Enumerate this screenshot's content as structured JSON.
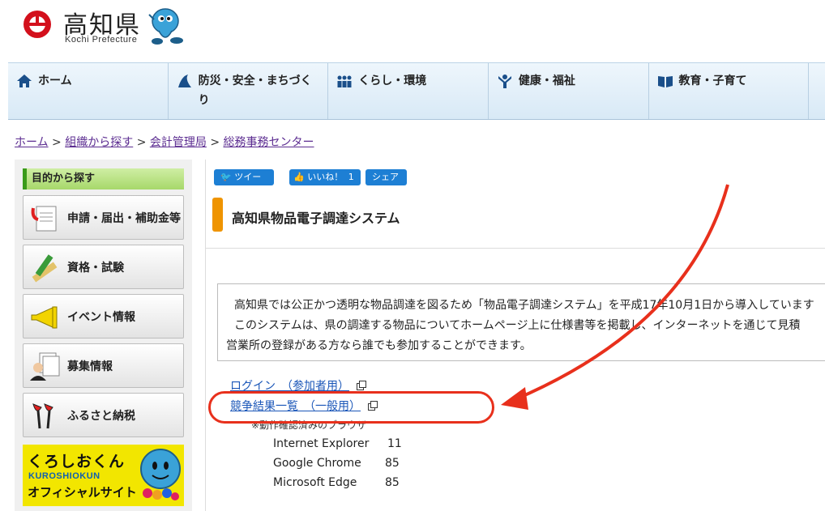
{
  "header": {
    "title": "高知県",
    "subtitle": "Kochi Prefecture"
  },
  "nav": [
    {
      "label": "ホーム",
      "icon": "home-icon"
    },
    {
      "label": "防災・安全・まちづくり",
      "icon": "tsunami-icon"
    },
    {
      "label": "くらし・環境",
      "icon": "people-icon"
    },
    {
      "label": "健康・福祉",
      "icon": "person-arms-icon"
    },
    {
      "label": "教育・子育て",
      "icon": "book-icon"
    }
  ],
  "breadcrumb": {
    "items": [
      "ホーム",
      "組織から探す",
      "会計管理局",
      "総務事務センター"
    ],
    "separator": ">"
  },
  "sidebar": {
    "heading": "目的から探す",
    "items": [
      {
        "label": "申請・届出・補助金等",
        "icon": "form-icon"
      },
      {
        "label": "資格・試験",
        "icon": "pencil-ruler-icon"
      },
      {
        "label": "イベント情報",
        "icon": "megaphone-icon"
      },
      {
        "label": "募集情報",
        "icon": "recruit-icon"
      },
      {
        "label": "ふるさと納税",
        "icon": "naruko-icon"
      }
    ],
    "banner": {
      "jp": "くろしおくん",
      "en": "KUROSHIOKUN",
      "site": "オフィシャルサイト"
    }
  },
  "social": {
    "tweet": "ツイート",
    "like": "いいね！",
    "like_count": "1",
    "share": "シェア"
  },
  "page": {
    "title": "高知県物品電子調達システム",
    "intro_lines": [
      "高知県では公正かつ透明な物品調達を図るため「物品電子調達システム」を平成17年10月1日から導入しています",
      "このシステムは、県の調達する物品についてホームページ上に仕様書等を掲載し、インターネットを通じて見積",
      "営業所の登録がある方なら誰でも参加することができます。"
    ],
    "links": [
      {
        "label": "ログイン　（参加者用）"
      },
      {
        "label": "競争結果一覧　（一般用）"
      }
    ],
    "browser_note": "※動作確認済みのブラウザ",
    "browsers": [
      {
        "name": "Internet Explorer",
        "version": "11"
      },
      {
        "name": "Google Chrome",
        "version": "85"
      },
      {
        "name": "Microsoft Edge",
        "version": "85"
      }
    ]
  },
  "colors": {
    "annotation": "#e8301c",
    "link": "#1a56b8",
    "title_bar": "#ef9400"
  }
}
